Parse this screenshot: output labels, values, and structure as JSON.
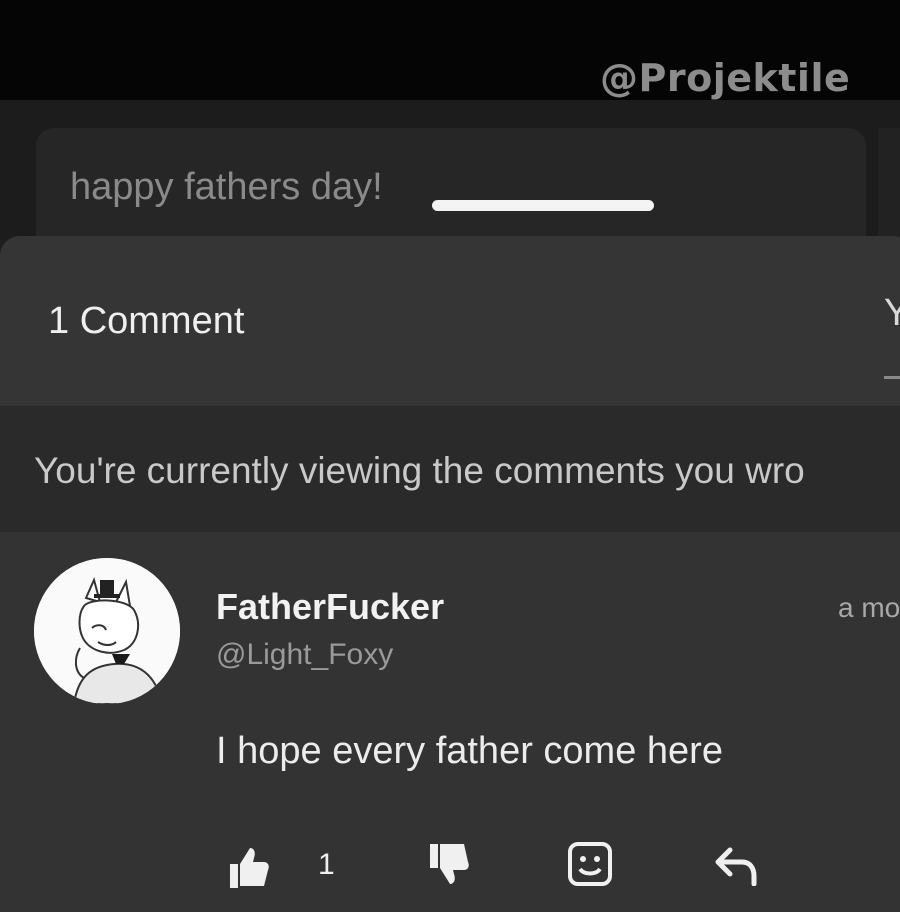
{
  "watermark": "@Projektile",
  "post": {
    "text": "happy fathers day!"
  },
  "comments_sheet": {
    "count_label": "1 Comment",
    "header_right_glyph": "Y",
    "notice": "You're currently viewing the comments you wro"
  },
  "comment": {
    "display_name": "FatherFucker",
    "handle": "@Light_Foxy",
    "timestamp": "a mo",
    "text": "I hope every father come here",
    "like_count": "1"
  },
  "icons": {
    "like": "thumbs-up-icon",
    "dislike": "thumbs-down-icon",
    "emoji": "emoji-reaction-icon",
    "reply": "reply-icon"
  },
  "colors": {
    "background": "#1e1e1e",
    "sheet": "#333333",
    "notice_bg": "#2a2a2a"
  }
}
